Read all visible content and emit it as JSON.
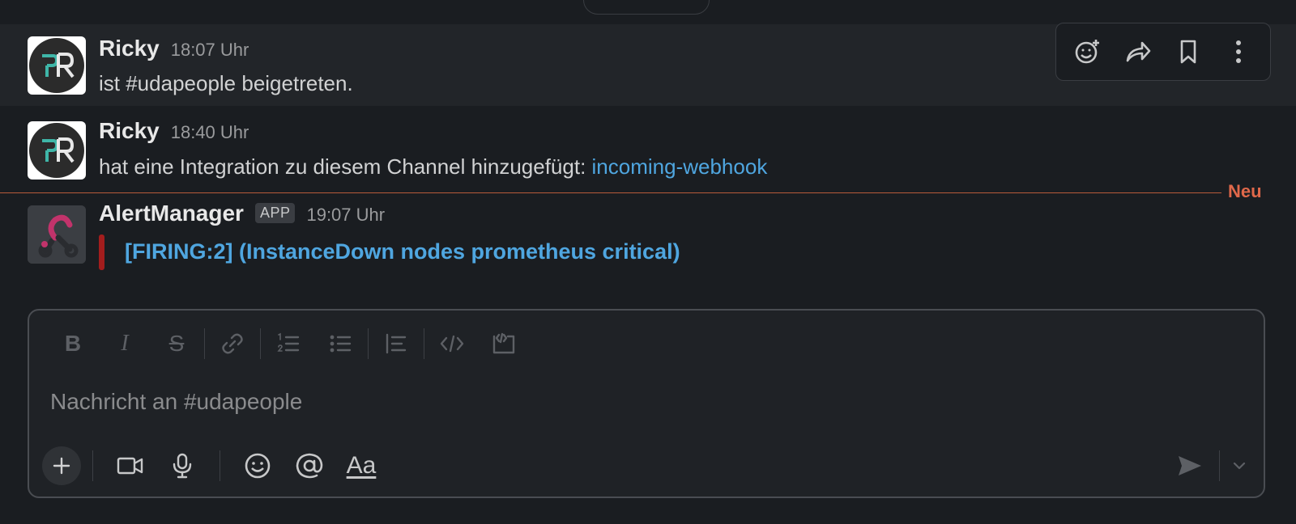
{
  "messages": [
    {
      "author": "Ricky",
      "time": "18:07 Uhr",
      "text": "ist #udapeople beigetreten."
    },
    {
      "author": "Ricky",
      "time": "18:40 Uhr",
      "text": "hat eine Integration zu diesem Channel hinzugefügt: ",
      "link": "incoming-webhook"
    },
    {
      "author": "AlertManager",
      "badge": "APP",
      "time": "19:07 Uhr",
      "attachment_title": "[FIRING:2]  (InstanceDown nodes prometheus critical)"
    }
  ],
  "new_divider": {
    "label": "Neu"
  },
  "composer": {
    "placeholder": "Nachricht an #udapeople",
    "aa_label": "Aa"
  },
  "colors": {
    "background": "#1a1d21",
    "link": "#4fa6e0",
    "new_divider": "#e0684a",
    "attachment_bar": "#a31d1d"
  },
  "icons": {
    "message_actions": [
      "add-reaction-icon",
      "share-icon",
      "bookmark-icon",
      "more-vertical-icon"
    ],
    "format_toolbar": [
      "bold-icon",
      "italic-icon",
      "strikethrough-icon",
      "link-icon",
      "ordered-list-icon",
      "bulleted-list-icon",
      "blockquote-icon",
      "code-icon",
      "code-block-icon"
    ],
    "composer_actions": [
      "plus-icon",
      "video-icon",
      "microphone-icon",
      "emoji-icon",
      "mention-icon",
      "formatting-icon",
      "send-icon",
      "chevron-down-icon"
    ]
  }
}
